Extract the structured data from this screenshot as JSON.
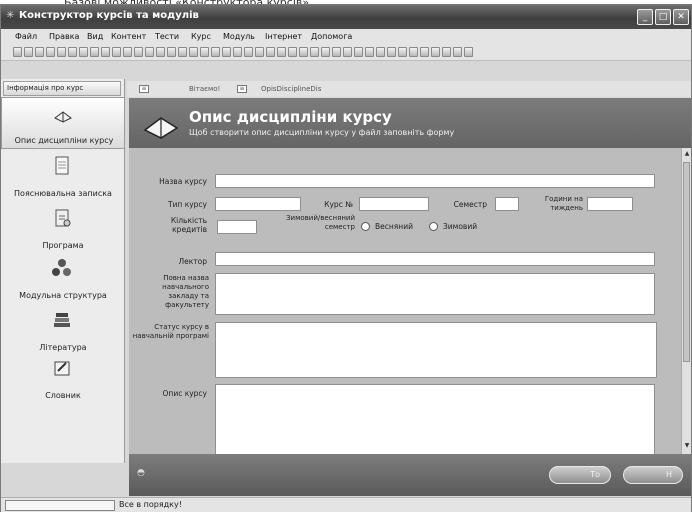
{
  "caption": "Базові можливості «Конструктора курсів».",
  "window": {
    "title": "Конструктор курсів та модулів",
    "minimize": "_",
    "maximize": "□",
    "close": "✕"
  },
  "menu": [
    "Файл",
    "Правка",
    "Вид",
    "Контент",
    "Тести",
    "Курс",
    "Модуль",
    "Інтернет",
    "Допомога"
  ],
  "sidebar": {
    "header": "Інформація про курс",
    "items": [
      {
        "label": "Опис дисципліни курсу",
        "icon": "book-icon"
      },
      {
        "label": "Пояснювальна записка",
        "icon": "document-icon"
      },
      {
        "label": "Програма",
        "icon": "program-icon"
      },
      {
        "label": "Модульна структура",
        "icon": "module-structure-icon"
      },
      {
        "label": "Література",
        "icon": "books-stack-icon"
      },
      {
        "label": "Словник",
        "icon": "dictionary-icon"
      }
    ]
  },
  "tabs": [
    "Вітаємо!",
    "OpisDisciplineDis"
  ],
  "banner": {
    "title": "Опис дисципліни курсу",
    "subtitle": "Щоб створити опис дисципліни курсу у файл заповніть форму"
  },
  "form": {
    "course_name": {
      "label": "Назва курсу",
      "value": ""
    },
    "course_type": {
      "label": "Тип курсу",
      "value": ""
    },
    "course_no": {
      "label": "Курс №",
      "value": ""
    },
    "semester": {
      "label": "Семестр",
      "value": ""
    },
    "hours": {
      "label": "Години на тиждень",
      "value": ""
    },
    "credits": {
      "label": "Кількість кредитів",
      "value": ""
    },
    "semester_type": {
      "label": "Зимовий/весняний семестр",
      "options": [
        "Весняний",
        "Зимовий"
      ]
    },
    "lecturer": {
      "label": "Лектор",
      "value": ""
    },
    "institution": {
      "label": "Повна назва навчального закладу та факультету",
      "value": ""
    },
    "status": {
      "label": "Статус курсу в навчальній програмі",
      "value": ""
    },
    "description": {
      "label": "Опис курсу",
      "value": ""
    }
  },
  "footer": {
    "back_button": "Тo",
    "next_button": "Н"
  },
  "status_bar": {
    "text": "Все в порядку!"
  }
}
